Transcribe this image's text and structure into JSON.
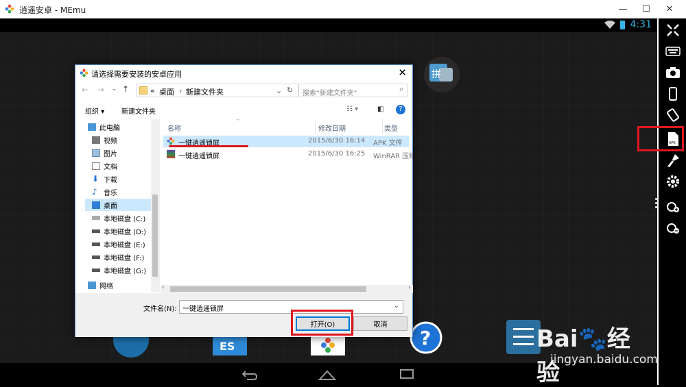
{
  "window": {
    "title": "逍遥安卓 - MEmu",
    "controls": [
      "minimize-icon",
      "maximize-icon",
      "close-icon"
    ]
  },
  "status_bar": {
    "time": "4:31"
  },
  "dialog": {
    "title": "请选择需要安装的安卓应用",
    "breadcrumb": {
      "prefix": "«",
      "items": [
        "桌面",
        "新建文件夹"
      ]
    },
    "search_placeholder": "搜索\"新建文件夹\"",
    "toolbar": {
      "organize": "组织 ▾",
      "new_folder": "新建文件夹"
    },
    "nav_items": [
      {
        "label": "此电脑",
        "icon": "computer-icon"
      },
      {
        "label": "视频",
        "icon": "video-folder-icon"
      },
      {
        "label": "图片",
        "icon": "pictures-folder-icon"
      },
      {
        "label": "文档",
        "icon": "documents-folder-icon"
      },
      {
        "label": "下载",
        "icon": "download-icon"
      },
      {
        "label": "音乐",
        "icon": "music-icon"
      },
      {
        "label": "桌面",
        "icon": "desktop-icon"
      },
      {
        "label": "本地磁盘 (C:)",
        "icon": "windows-drive-icon"
      },
      {
        "label": "本地磁盘 (D:)",
        "icon": "drive-icon"
      },
      {
        "label": "本地磁盘 (E:)",
        "icon": "drive-icon"
      },
      {
        "label": "本地磁盘 (F:)",
        "icon": "drive-icon"
      },
      {
        "label": "本地磁盘 (G:)",
        "icon": "drive-icon"
      },
      {
        "label": "网络",
        "icon": "network-icon"
      }
    ],
    "columns": [
      "名称",
      "修改日期",
      "类型"
    ],
    "files": [
      {
        "name": "一键逍遥锁屏",
        "modified": "2015/6/30 16:14",
        "type": "APK 文件",
        "icon": "apk-file-icon"
      },
      {
        "name": "一键逍遥锁屏",
        "modified": "2015/6/30 16:25",
        "type": "WinRAR 压缩",
        "icon": "rar-file-icon"
      }
    ],
    "filename_label": "文件名(N):",
    "filename_value": "一键逍遥锁屏",
    "open_button": "打开(O)",
    "cancel_button": "取消"
  },
  "watermark": {
    "brand": "Bai",
    "brand_suffix": "经验",
    "url": "jingyan.baidu.com"
  },
  "colors": {
    "accent": "#33b5e5",
    "highlight": "#e0161e",
    "selection": "#cce8ff"
  }
}
